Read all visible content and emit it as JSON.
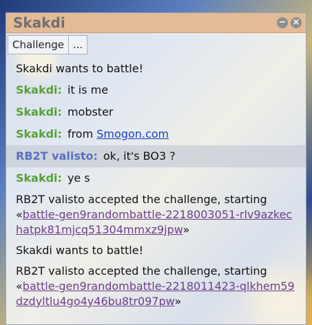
{
  "window": {
    "title": "Skakdi"
  },
  "toolbar": {
    "challenge_label": "Challenge",
    "more_label": "..."
  },
  "colors": {
    "titlebar": "#e3bb96",
    "user_green": "#58a038",
    "user_blue": "#5a6fc0",
    "link": "#1a3fc0",
    "battle_link": "#6c3f8a"
  },
  "log": {
    "notice1": "Skakdi wants to battle!",
    "chat": [
      {
        "user": "Skakdi:",
        "text": "it is me"
      },
      {
        "user": "Skakdi:",
        "text": "mobster"
      },
      {
        "user": "Skakdi:",
        "text": "from ",
        "link": "Smogon.com"
      },
      {
        "user": "RB2T valisto:",
        "text": "ok, it's BO3 ?"
      },
      {
        "user": "Skakdi:",
        "text": "ye s"
      }
    ],
    "accept1": {
      "text": "RB2T valisto accepted the challenge, starting",
      "open": "«",
      "link": "battle-gen9randombattle-2218003051-rlv9azkechatpk81mjcq51304mmxz9jpw",
      "close": "»"
    },
    "notice2": "Skakdi wants to battle!",
    "accept2": {
      "text": "RB2T valisto accepted the challenge, starting",
      "open": "«",
      "link": "battle-gen9randombattle-2218011423-qlkhem59dzdyltlu4go4y46bu8tr097pw",
      "close": "»"
    }
  }
}
